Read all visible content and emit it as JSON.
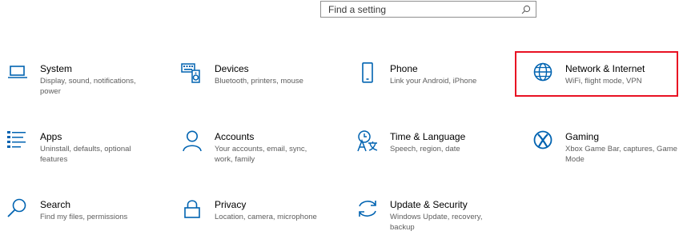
{
  "search": {
    "placeholder": "Find a setting"
  },
  "accent_color": "#0063b1",
  "highlight_color": "#e81123",
  "tiles": [
    {
      "icon": "laptop-icon",
      "title": "System",
      "desc": "Display, sound, notifications, power"
    },
    {
      "icon": "keyboard-speaker-icon",
      "title": "Devices",
      "desc": "Bluetooth, printers, mouse"
    },
    {
      "icon": "phone-icon",
      "title": "Phone",
      "desc": "Link your Android, iPhone"
    },
    {
      "icon": "globe-icon",
      "title": "Network & Internet",
      "desc": "WiFi, flight mode, VPN"
    },
    {
      "icon": "apps-list-icon",
      "title": "Apps",
      "desc": "Uninstall, defaults, optional features"
    },
    {
      "icon": "person-icon",
      "title": "Accounts",
      "desc": "Your accounts, email, sync, work, family"
    },
    {
      "icon": "time-language-icon",
      "title": "Time & Language",
      "desc": "Speech, region, date"
    },
    {
      "icon": "xbox-icon",
      "title": "Gaming",
      "desc": "Xbox Game Bar, captures, Game Mode"
    },
    {
      "icon": "search-icon",
      "title": "Search",
      "desc": "Find my files, permissions"
    },
    {
      "icon": "lock-icon",
      "title": "Privacy",
      "desc": "Location, camera, microphone"
    },
    {
      "icon": "sync-icon",
      "title": "Update & Security",
      "desc": "Windows Update, recovery, backup"
    }
  ]
}
